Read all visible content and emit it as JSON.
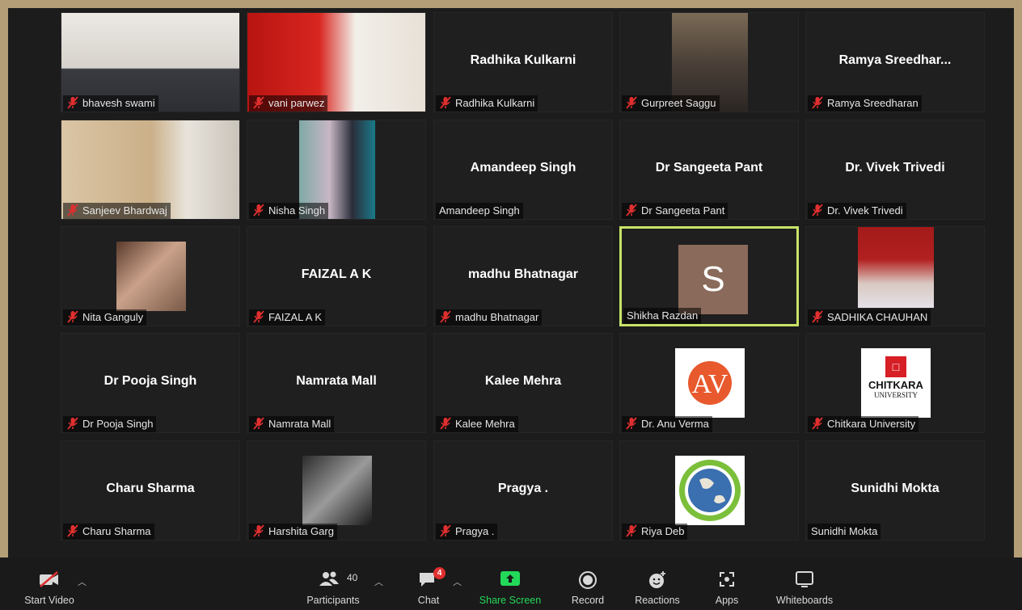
{
  "participants": [
    {
      "name": "bhavesh swami",
      "display": "video",
      "muted": true
    },
    {
      "name": "vani parwez",
      "display": "video",
      "muted": true
    },
    {
      "name": "Radhika Kulkarni",
      "display": "name",
      "big": "Radhika Kulkarni",
      "muted": true
    },
    {
      "name": "Gurpreet Saggu",
      "display": "video",
      "muted": true
    },
    {
      "name": "Ramya Sreedharan",
      "display": "name",
      "big": "Ramya  Sreedhar...",
      "muted": true
    },
    {
      "name": "Sanjeev Bhardwaj",
      "display": "video",
      "muted": true
    },
    {
      "name": "Nisha Singh",
      "display": "video",
      "muted": true
    },
    {
      "name": "Amandeep Singh",
      "display": "name",
      "big": "Amandeep Singh",
      "muted": false
    },
    {
      "name": "Dr Sangeeta Pant",
      "display": "name",
      "big": "Dr Sangeeta Pant",
      "muted": true
    },
    {
      "name": "Dr. Vivek Trivedi",
      "display": "name",
      "big": "Dr. Vivek Trivedi",
      "muted": true
    },
    {
      "name": "Nita Ganguly",
      "display": "video",
      "muted": true
    },
    {
      "name": "FAIZAL A K",
      "display": "name",
      "big": "FAIZAL A K",
      "muted": true
    },
    {
      "name": "madhu Bhatnagar",
      "display": "name",
      "big": "madhu Bhatnagar",
      "muted": true
    },
    {
      "name": "Shikha Razdan",
      "display": "initial",
      "initial": "S",
      "muted": false,
      "speaking": true
    },
    {
      "name": "SADHIKA CHAUHAN",
      "display": "video",
      "muted": true
    },
    {
      "name": "Dr Pooja Singh",
      "display": "name",
      "big": "Dr Pooja Singh",
      "muted": true
    },
    {
      "name": "Namrata Mall",
      "display": "name",
      "big": "Namrata Mall",
      "muted": true
    },
    {
      "name": "Kalee Mehra",
      "display": "name",
      "big": "Kalee Mehra",
      "muted": true
    },
    {
      "name": "Dr. Anu Verma",
      "display": "logo-av",
      "logo_text": "AV",
      "muted": true
    },
    {
      "name": "Chitkara University",
      "display": "logo-chitkara",
      "logo_text": "CHITKARA",
      "logo_sub": "UNIVERSITY",
      "muted": true
    },
    {
      "name": "Charu Sharma",
      "display": "name",
      "big": "Charu Sharma",
      "muted": true
    },
    {
      "name": "Harshita Garg",
      "display": "video",
      "muted": true
    },
    {
      "name": "Pragya .",
      "display": "name",
      "big": "Pragya .",
      "muted": true
    },
    {
      "name": "Riya Deb",
      "display": "logo-earth",
      "muted": true
    },
    {
      "name": "Sunidhi Mokta",
      "display": "name",
      "big": "Sunidhi Mokta",
      "muted": false
    }
  ],
  "toolbar": {
    "start_video": "Start Video",
    "participants": "Participants",
    "participant_count": "40",
    "chat": "Chat",
    "chat_badge": "4",
    "share_screen": "Share Screen",
    "record": "Record",
    "reactions": "Reactions",
    "apps": "Apps",
    "whiteboards": "Whiteboards"
  },
  "colors": {
    "speaker_border": "#c7e368",
    "share_green": "#23d959",
    "mute_red": "#e02f2f",
    "badge_red": "#e02f2f"
  }
}
